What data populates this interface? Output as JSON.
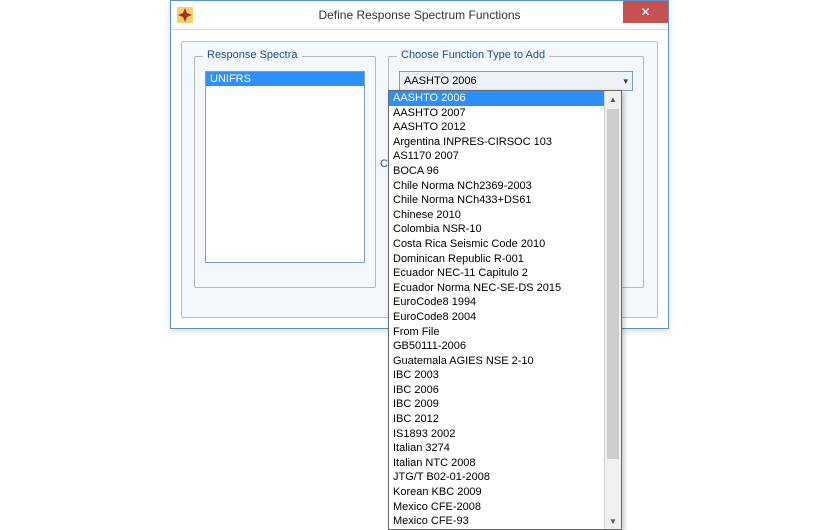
{
  "window": {
    "title": "Define Response Spectrum Functions",
    "close_glyph": "✕"
  },
  "left_panel": {
    "title": "Response Spectra",
    "items": [
      "UNIFRS"
    ]
  },
  "right_panel": {
    "title": "Choose  Function Type to Add",
    "combo_value": "AASHTO 2006",
    "combo_arrow": "▾"
  },
  "partial_label": "C",
  "dropdown": {
    "selected_index": 0,
    "options": [
      "AASHTO 2006",
      "AASHTO 2007",
      "AASHTO 2012",
      "Argentina INPRES-CIRSOC 103",
      "AS1170 2007",
      "BOCA 96",
      "Chile Norma NCh2369-2003",
      "Chile Norma NCh433+DS61",
      "Chinese 2010",
      "Colombia NSR-10",
      "Costa Rica Seismic Code 2010",
      "Dominican Republic R-001",
      "Ecuador NEC-11 Capitulo 2",
      "Ecuador Norma NEC-SE-DS 2015",
      "EuroCode8 1994",
      "EuroCode8 2004",
      "From File",
      "GB50111-2006",
      "Guatemala AGIES NSE 2-10",
      "IBC 2003",
      "IBC 2006",
      "IBC 2009",
      "IBC 2012",
      "IS1893 2002",
      "Italian 3274",
      "Italian NTC 2008",
      "JTG/T B02-01-2008",
      "Korean KBC 2009",
      "Mexico CFE-2008",
      "Mexico CFE-93"
    ],
    "scroll_up": "▲",
    "scroll_down": "▼"
  }
}
